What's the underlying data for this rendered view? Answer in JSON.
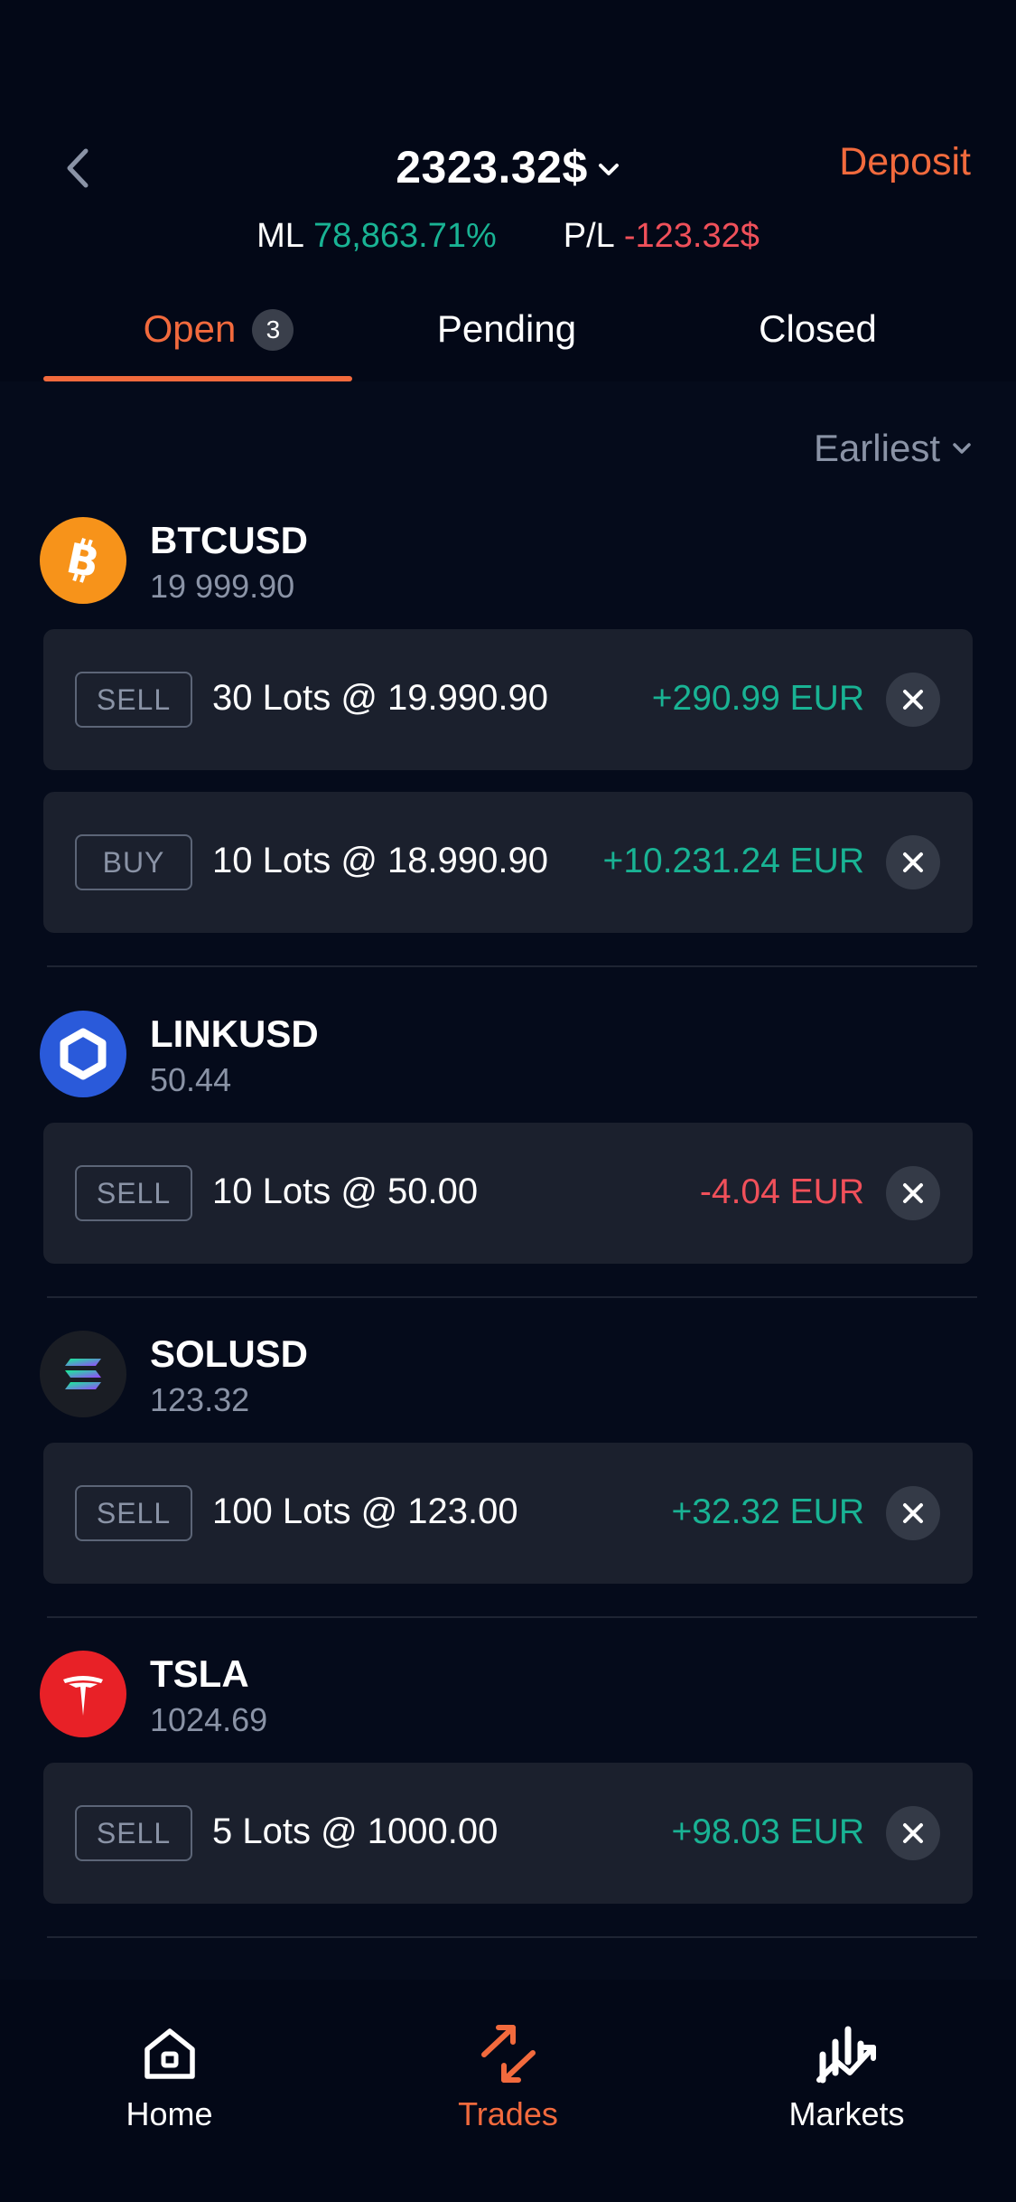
{
  "header": {
    "balance": "2323.32$",
    "deposit_label": "Deposit",
    "ml_label": "ML",
    "ml_value": "78,863.71%",
    "pl_label": "P/L",
    "pl_value": "-123.32$"
  },
  "tabs": [
    {
      "label": "Open",
      "count": "3",
      "active": true
    },
    {
      "label": "Pending",
      "active": false
    },
    {
      "label": "Closed",
      "active": false
    }
  ],
  "sort": {
    "label": "Earliest"
  },
  "assets": [
    {
      "symbol": "BTCUSD",
      "price": "19 999.90",
      "icon": "bitcoin-icon",
      "trades": [
        {
          "type": "SELL",
          "desc": "30 Lots @ 19.990.90",
          "pl": "+290.99 EUR"
        },
        {
          "type": "BUY",
          "desc": "10 Lots @ 18.990.90",
          "pl": "+10.231.24 EUR"
        }
      ]
    },
    {
      "symbol": "LINKUSD",
      "price": "50.44",
      "icon": "chainlink-icon",
      "trades": [
        {
          "type": "SELL",
          "desc": "10 Lots @ 50.00",
          "pl": "-4.04 EUR"
        }
      ]
    },
    {
      "symbol": "SOLUSD",
      "price": "123.32",
      "icon": "solana-icon",
      "trades": [
        {
          "type": "SELL",
          "desc": "100 Lots @ 123.00",
          "pl": "+32.32 EUR"
        }
      ]
    },
    {
      "symbol": "TSLA",
      "price": "1024.69",
      "icon": "tesla-icon",
      "trades": [
        {
          "type": "SELL",
          "desc": "5 Lots @ 1000.00",
          "pl": "+98.03 EUR"
        }
      ]
    }
  ],
  "nav": [
    {
      "label": "Home",
      "icon": "home-icon",
      "active": false
    },
    {
      "label": "Trades",
      "icon": "trades-icon",
      "active": true
    },
    {
      "label": "Markets",
      "icon": "markets-icon",
      "active": false
    }
  ],
  "colors": {
    "accent": "#f26a3d",
    "positive": "#19b394",
    "negative": "#f0505a",
    "background": "#050b1b",
    "card": "#1b202d"
  }
}
